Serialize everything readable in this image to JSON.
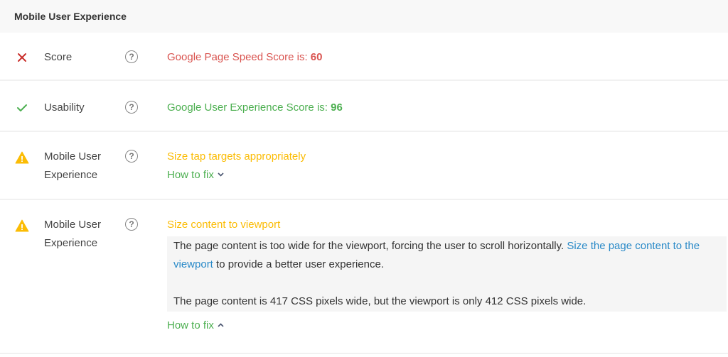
{
  "header": {
    "title": "Mobile User Experience"
  },
  "rows": [
    {
      "status": "fail",
      "status_icon": "x-icon",
      "label": "Score",
      "help_icon": "question-circle-icon",
      "help_glyph": "?",
      "message_prefix": "Google Page Speed Score is: ",
      "message_value": "60",
      "color": "#d9534f"
    },
    {
      "status": "pass",
      "status_icon": "check-icon",
      "label": "Usability",
      "help_icon": "question-circle-icon",
      "help_glyph": "?",
      "message_prefix": "Google User Experience Score is: ",
      "message_value": "96",
      "color": "#4caf50"
    },
    {
      "status": "warning",
      "status_icon": "warning-triangle-icon",
      "label": "Mobile User Experience",
      "help_icon": "question-circle-icon",
      "help_glyph": "?",
      "message": "Size tap targets appropriately",
      "how_to_fix": "How to fix",
      "how_to_fix_expanded": false,
      "color": "#fbbc05"
    },
    {
      "status": "warning",
      "status_icon": "warning-triangle-icon",
      "label": "Mobile User Experience",
      "help_icon": "question-circle-icon",
      "help_glyph": "?",
      "message": "Size content to viewport",
      "detail": {
        "text_before_link": "The page content is too wide for the viewport, forcing the user to scroll horizontally. ",
        "link_text": "Size the page content to the viewport",
        "text_after_link": " to provide a better user experience.",
        "second_paragraph": "The page content is 417 CSS pixels wide, but the viewport is only 412 CSS pixels wide."
      },
      "how_to_fix": "How to fix",
      "how_to_fix_expanded": true,
      "color": "#fbbc05"
    }
  ],
  "colors": {
    "fail": "#d9534f",
    "pass": "#4caf50",
    "warning": "#fbbc05",
    "link": "#2a8ac8"
  }
}
